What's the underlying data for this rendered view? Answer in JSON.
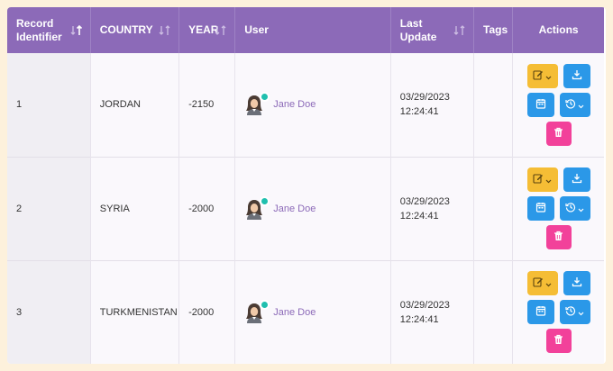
{
  "table": {
    "columns": [
      {
        "label_line1": "Record",
        "label_line2": "Identifier",
        "sort": "asc"
      },
      {
        "label_line1": "COUNTRY",
        "label_line2": "",
        "sort": "none"
      },
      {
        "label_line1": "YEAR",
        "label_line2": "",
        "sort": "none"
      },
      {
        "label_line1": "User",
        "label_line2": "",
        "sort": ""
      },
      {
        "label_line1": "Last",
        "label_line2": "Update",
        "sort": "none"
      },
      {
        "label_line1": "Tags",
        "label_line2": "",
        "sort": ""
      },
      {
        "label_line1": "Actions",
        "label_line2": "",
        "sort": ""
      }
    ],
    "rows": [
      {
        "id": "1",
        "country": "JORDAN",
        "year": "-2150",
        "user": "Jane Doe",
        "date": "03/29/2023",
        "time": "12:24:41",
        "tags": ""
      },
      {
        "id": "2",
        "country": "SYRIA",
        "year": "-2000",
        "user": "Jane Doe",
        "date": "03/29/2023",
        "time": "12:24:41",
        "tags": ""
      },
      {
        "id": "3",
        "country": "TURKMENISTAN",
        "year": "-2000",
        "user": "Jane Doe",
        "date": "03/29/2023",
        "time": "12:24:41",
        "tags": ""
      }
    ]
  },
  "colors": {
    "header_bg": "#8c6ab8",
    "user_link": "#8c6ab8",
    "presence": "#1fbfae",
    "edit_button": "#f5bd35",
    "blue_button": "#2b98e8",
    "delete_button": "#f2419a"
  },
  "icons": {
    "edit": "edit-icon",
    "download": "download-icon",
    "calendar": "calendar-icon",
    "history": "history-icon",
    "delete": "trash-icon",
    "sort_active": "sort-ascending-icon",
    "sort_inactive": "sort-icon"
  }
}
